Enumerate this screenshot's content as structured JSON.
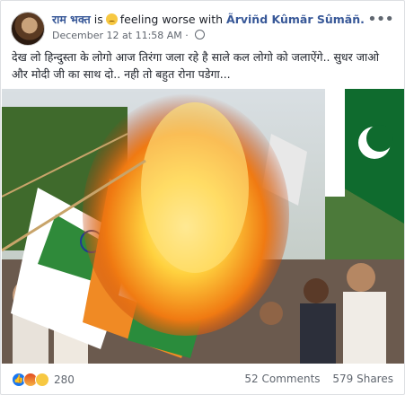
{
  "post": {
    "author": "राम भक्त",
    "feeling_prefix": "is",
    "feeling_text": "feeling worse with",
    "tagged_user": "Ãrviñd Kûmãr Sûmãñ.",
    "timestamp": "December 12 at 11:58 AM",
    "meta_separator": "·",
    "more_label": "•••",
    "text": "देख लो हिन्दुस्ता के लोगो आज तिरंगा जला रहे है साले कल लोगो को जलाऐंगे.. सुधर जाओ और मोदी जी का साथ दो.. नही तो बहुत रोना पडेगा..."
  },
  "footer": {
    "reaction_count": "280",
    "comments": "52 Comments",
    "shares": "579 Shares"
  },
  "icons": {
    "feeling": "worried-face-icon",
    "privacy": "globe-icon",
    "reactions": [
      "like-icon",
      "angry-icon",
      "sad-icon"
    ]
  }
}
